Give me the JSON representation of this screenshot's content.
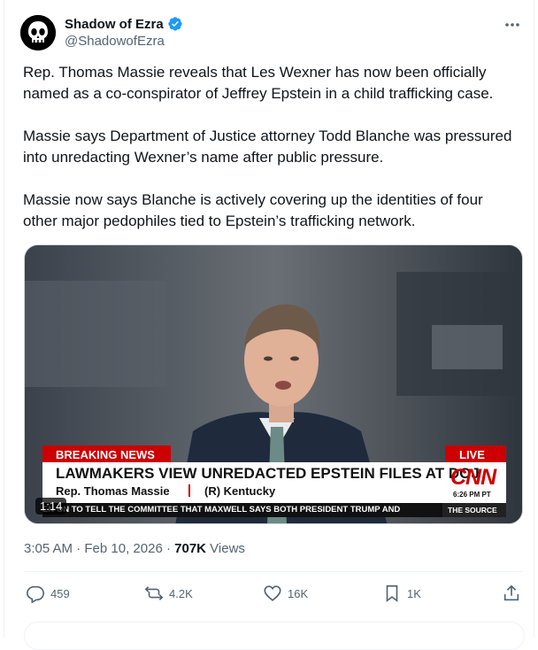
{
  "author": {
    "display_name": "Shadow of Ezra",
    "handle": "@ShadowofEzra"
  },
  "tweet": {
    "paragraphs": [
      "Rep. Thomas Massie reveals that Les Wexner has now been officially named as a co-conspirator of Jeffrey Epstein in a child trafficking case.",
      "Massie says Department of Justice attorney Todd Blanche was pressured into unredacting Wexner’s name after public pressure.",
      "Massie now says Blanche is actively covering up the identities of four other major pedophiles tied to Epstein’s trafficking network."
    ]
  },
  "video": {
    "duration": "1:14",
    "breaking_label": "BREAKING NEWS",
    "live_label": "LIVE",
    "headline": "LAWMAKERS VIEW UNREDACTED EPSTEIN FILES AT DOJ",
    "guest_name": "Rep. Thomas Massie",
    "guest_affiliation": "(R) Kentucky",
    "network": "CNN",
    "time_label": "6:26 PM PT",
    "ticker": "EN ON TO TELL THE COMMITTEE THAT MAXWELL SAYS BOTH PRESIDENT TRUMP AND",
    "show_name": "THE SOURCE"
  },
  "meta": {
    "time": "3:05 AM",
    "separator": "·",
    "date": "Feb 10, 2026",
    "views_count": "707K",
    "views_label": "Views"
  },
  "actions": {
    "replies": "459",
    "reposts": "4.2K",
    "likes": "16K",
    "bookmarks": "1K"
  },
  "colors": {
    "verified": "#1d9bf0",
    "breaking_red": "#cc0000",
    "muted": "#536471"
  }
}
